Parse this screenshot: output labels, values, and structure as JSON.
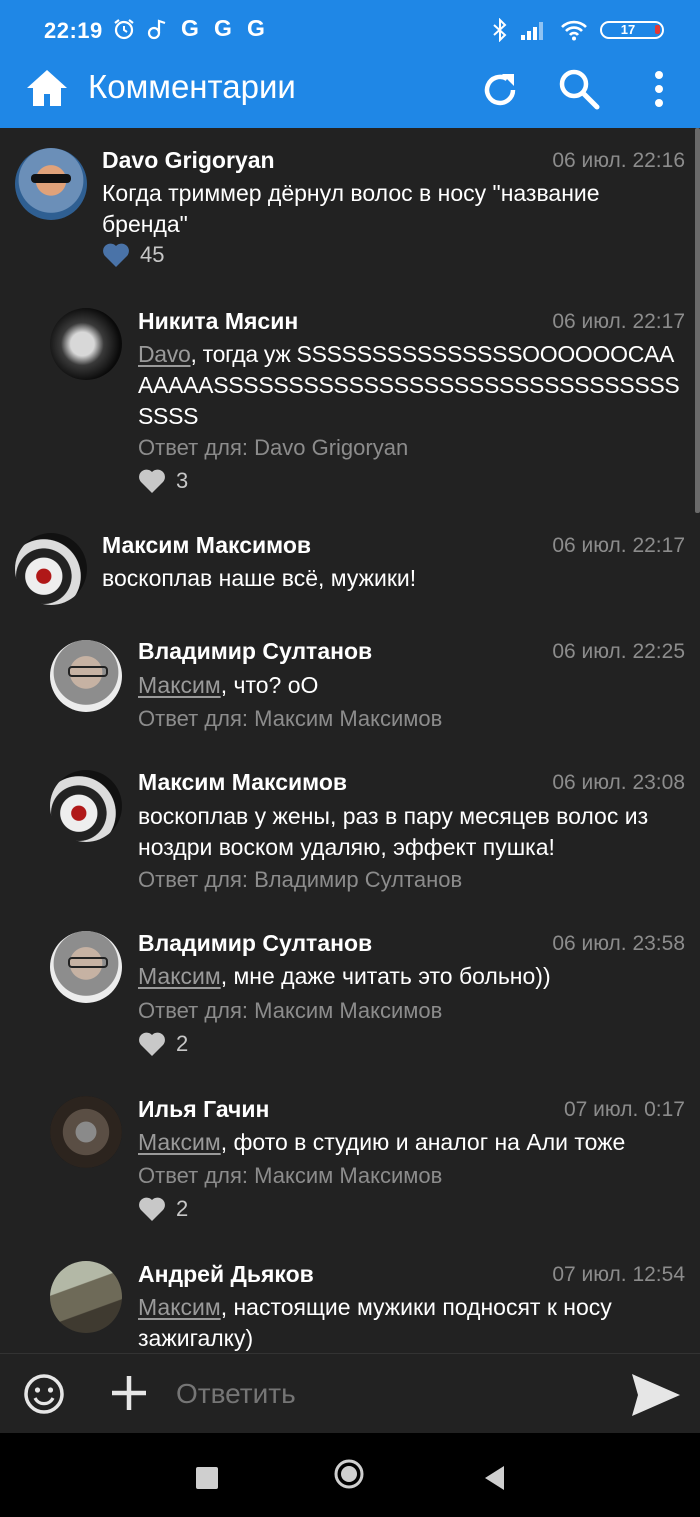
{
  "status": {
    "time": "22:19",
    "g_icons": [
      "G",
      "G",
      "G"
    ],
    "battery": "17"
  },
  "appbar": {
    "title": "Комментарии"
  },
  "comments": [
    {
      "author": "Davo Grigoryan",
      "date": "06 июл. 22:16",
      "text": "Когда триммер дёрнул волос в носу \"название бренда\"",
      "likes": "45"
    },
    {
      "author": "Никита Мясин",
      "date": "06 июл. 22:17",
      "mention": "Davo",
      "text": ", тогда уж SSSSSSSSSSSSSSSOOOOOOCAAAAAAASSSSSSSSSSSSSSSSSSSSSSSSSSSSSSSSSSS",
      "reply_to": "Ответ для: Davo Grigoryan",
      "likes": "3"
    },
    {
      "author": "Максим Максимов",
      "date": "06 июл. 22:17",
      "text": "воскоплав наше всё, мужики!"
    },
    {
      "author": "Владимир Султанов",
      "date": "06 июл. 22:25",
      "mention": "Максим",
      "text": ", что? оО",
      "reply_to": "Ответ для: Максим Максимов"
    },
    {
      "author": "Максим Максимов",
      "date": "06 июл. 23:08",
      "text": "воскоплав у жены, раз в пару месяцев волос из ноздри воском удаляю, эффект пушка!",
      "reply_to": "Ответ для: Владимир Султанов"
    },
    {
      "author": "Владимир Султанов",
      "date": "06 июл. 23:58",
      "mention": "Максим",
      "text": ", мне даже читать это больно))",
      "reply_to": "Ответ для: Максим Максимов",
      "likes": "2"
    },
    {
      "author": "Илья Гачин",
      "date": "07 июл. 0:17",
      "mention": "Максим",
      "text": ", фото в студию и аналог на Али тоже",
      "reply_to": "Ответ для: Максим Максимов",
      "likes": "2"
    },
    {
      "author": "Андрей Дьяков",
      "date": "07 июл. 12:54",
      "mention": "Максим",
      "text": ", настоящие мужики подносят к носу зажигалку)"
    }
  ],
  "input": {
    "placeholder": "Ответить"
  },
  "colors": {
    "accent": "#1f87e6",
    "background": "#222222",
    "liked_heart": "#4a73a8",
    "heart": "#c8c8c8"
  }
}
